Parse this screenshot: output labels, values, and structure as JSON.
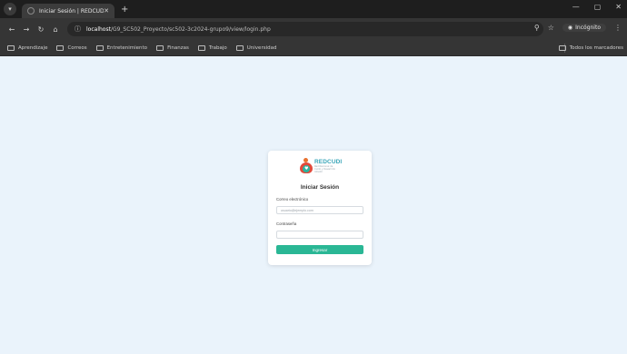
{
  "browser": {
    "tab": {
      "title": "Iniciar Sesión | REDCUDI"
    },
    "url": {
      "host": "localhost",
      "path": "/G9_SC502_Proyecto/sc502-3c2024-grupo9/view/login.php"
    },
    "incognito_label": "Incógnito",
    "bookmarks": [
      {
        "label": "Aprendizaje"
      },
      {
        "label": "Correos"
      },
      {
        "label": "Entretenimiento"
      },
      {
        "label": "Finanzas"
      },
      {
        "label": "Trabajo"
      },
      {
        "label": "Universidad"
      }
    ],
    "all_bookmarks_label": "Todos los marcadores"
  },
  "login": {
    "logo": {
      "name": "REDCUDI",
      "tagline": "Red Nacional de Cuido y Desarrollo Infantil"
    },
    "title": "Iniciar Sesión",
    "email": {
      "label": "Correo electrónico",
      "placeholder": "usuario@ejemplo.com",
      "value": ""
    },
    "password": {
      "label": "Contraseña",
      "placeholder": "",
      "value": ""
    },
    "submit_label": "Ingresar"
  },
  "colors": {
    "page_background": "#eaf3fb",
    "accent": "#2ab795",
    "brand_teal": "#3aa6b9",
    "chrome_dark": "#1e1e1e"
  },
  "icons": [
    "tab-list-icon",
    "globe-icon",
    "close-icon",
    "plus-icon",
    "back-icon",
    "forward-icon",
    "reload-icon",
    "home-icon",
    "site-info-icon",
    "zoom-icon",
    "star-icon",
    "incognito-icon",
    "menu-icon",
    "folder-icon",
    "minimize-icon",
    "maximize-icon"
  ]
}
